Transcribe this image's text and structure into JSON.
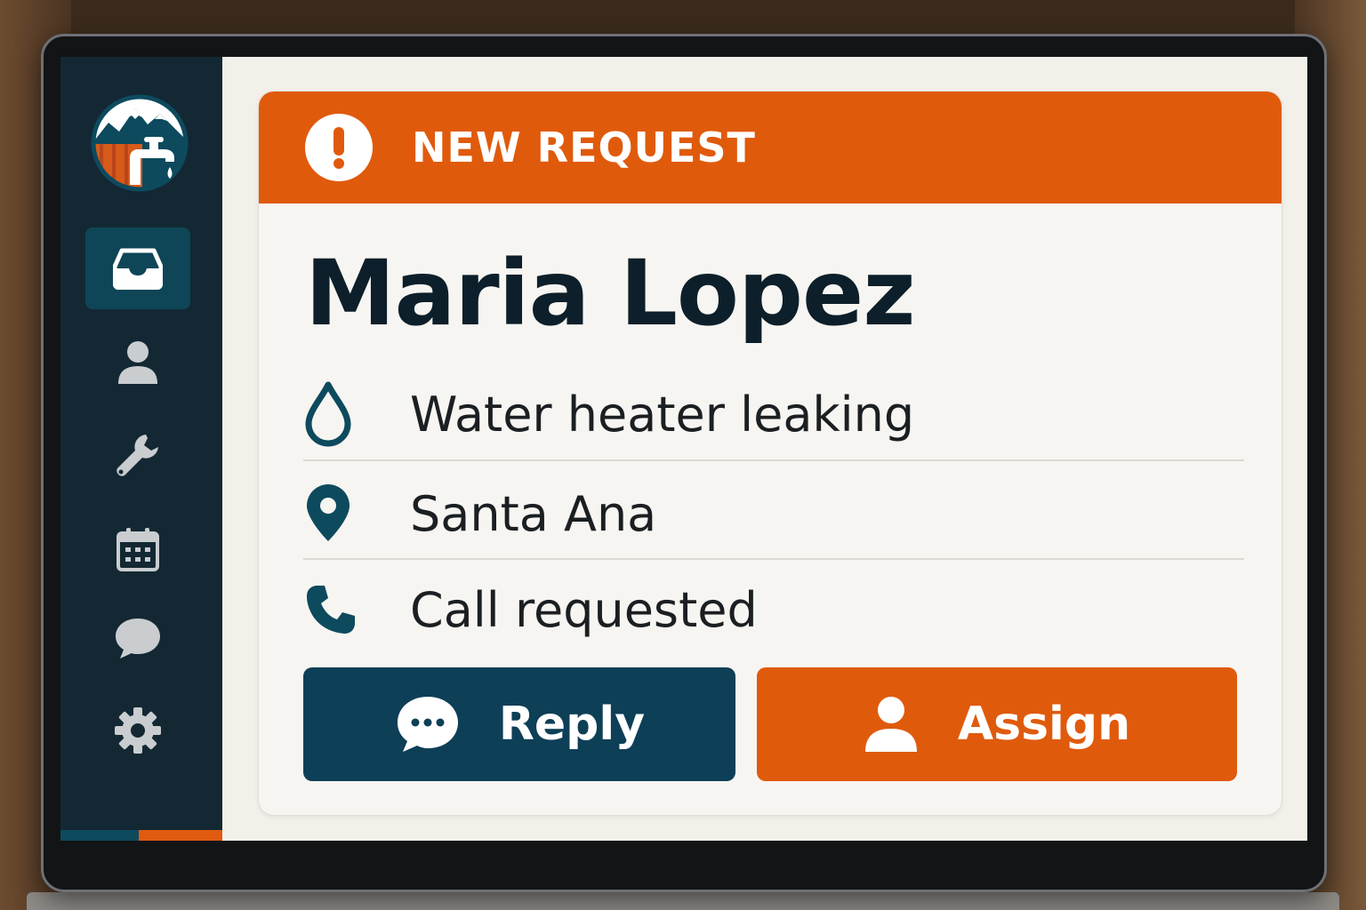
{
  "colors": {
    "sidebar_bg": "#132833",
    "accent_orange": "#e05a0c",
    "accent_teal": "#0d3f57",
    "card_bg": "#f7f5f1",
    "text_dark": "#0c1f2a"
  },
  "sidebar": {
    "logo_icon": "plumbing-mountain-logo",
    "items": [
      {
        "icon": "inbox-icon",
        "active": true
      },
      {
        "icon": "user-icon",
        "active": false
      },
      {
        "icon": "wrench-icon",
        "active": false
      },
      {
        "icon": "calendar-icon",
        "active": false
      },
      {
        "icon": "chat-bubble-icon",
        "active": false
      },
      {
        "icon": "gear-icon",
        "active": false
      }
    ]
  },
  "request": {
    "banner_icon": "alert-icon",
    "banner_title": "NEW REQUEST",
    "customer_name": "Maria Lopez",
    "details": [
      {
        "icon": "water-drop-icon",
        "text": "Water heater leaking"
      },
      {
        "icon": "map-pin-icon",
        "text": "Santa Ana"
      },
      {
        "icon": "phone-icon",
        "text": "Call requested"
      }
    ]
  },
  "actions": {
    "reply_label": "Reply",
    "reply_icon": "chat-dots-icon",
    "assign_label": "Assign",
    "assign_icon": "person-icon"
  }
}
